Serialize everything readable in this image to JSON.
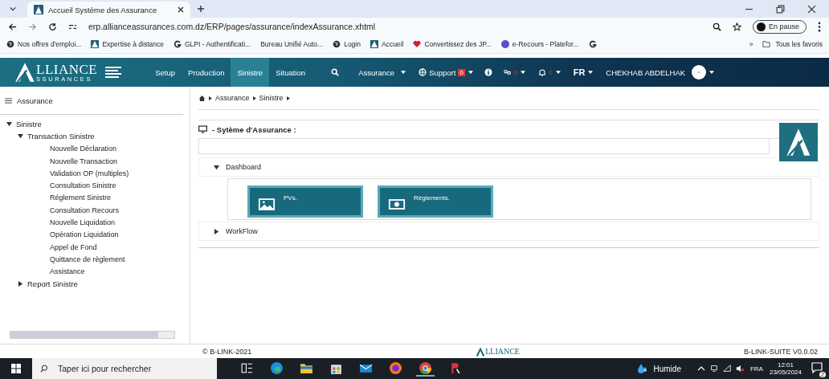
{
  "browser": {
    "tabs": [
      {
        "title": "Accueil Système des Assurance",
        "selected": true
      }
    ],
    "url": "erp.allianceassurances.com.dz/ERP/pages/assurance/indexAssurance.xhtml",
    "profile": "En pause",
    "bookmarks": [
      {
        "label": "Nos offres d'emploi...",
        "kind": "globe"
      },
      {
        "label": "Expertise à distance",
        "kind": "site"
      },
      {
        "label": "GLPI - Authentificati...",
        "kind": "letter"
      },
      {
        "label": "Bureau Unifié Auto...",
        "kind": "plain"
      },
      {
        "label": "Login",
        "kind": "globe"
      },
      {
        "label": "Accueil",
        "kind": "site"
      },
      {
        "label": "Convertissez des JP...",
        "kind": "heart"
      },
      {
        "label": "e-Recours - Platefor...",
        "kind": "badge"
      }
    ],
    "bookmarks_more": "»",
    "all_bookmarks": "Tous les favoris"
  },
  "app_bar": {
    "logo_main": "LLIANCE",
    "logo_sub": "SSURANCES",
    "menu": [
      {
        "label": "Setup",
        "selected": false
      },
      {
        "label": "Production",
        "selected": false
      },
      {
        "label": "Sinistre",
        "selected": true
      },
      {
        "label": "Situation",
        "selected": false
      }
    ],
    "module": "Assurance",
    "support": "Support",
    "support_badge": "0",
    "links_badge": "0",
    "alerts_badge": "0",
    "language": "FR",
    "user": "CHEKHAB ABDELHAK"
  },
  "sidebar": {
    "title": "Assurance",
    "tree": [
      {
        "label": "Sinistre",
        "expanded": true,
        "children": [
          {
            "label": "Transaction Sinistre",
            "expanded": true,
            "children": [
              {
                "label": "Nouvelle Déclaration"
              },
              {
                "label": "Nouvelle Transaction"
              },
              {
                "label": "Validation OP (multiples)"
              },
              {
                "label": "Consultation Sinistre"
              },
              {
                "label": "Réglement Sinistre"
              },
              {
                "label": "Consultation Recours"
              },
              {
                "label": "Nouvelle Liquidation"
              },
              {
                "label": "Opération Liquidation"
              },
              {
                "label": "Appel de Fond"
              },
              {
                "label": "Quittance de règlement"
              },
              {
                "label": "Assistance"
              }
            ]
          },
          {
            "label": "Report Sinistre",
            "expanded": false
          }
        ]
      }
    ]
  },
  "breadcrumb": [
    "Assurance",
    "Sinistre"
  ],
  "panel_title": "- Sytème d'Assurance :",
  "sections": [
    {
      "title": "Dashboard",
      "expanded": true,
      "tiles": [
        {
          "label": "PVs.",
          "kind": "image"
        },
        {
          "label": "Réglements.",
          "kind": "money"
        }
      ]
    },
    {
      "title": "WorkFlow",
      "expanded": false
    }
  ],
  "footer": {
    "copyright": "© B-LINK-2021",
    "logo_main": "LLIANCE",
    "version": "B-LINK-SUITE V0.0.02"
  },
  "taskbar": {
    "search": "Taper ici pour rechercher",
    "weather": "Humide",
    "language": "FRA",
    "time": "12:01",
    "date": "23/05/2024",
    "notifications": "2"
  }
}
